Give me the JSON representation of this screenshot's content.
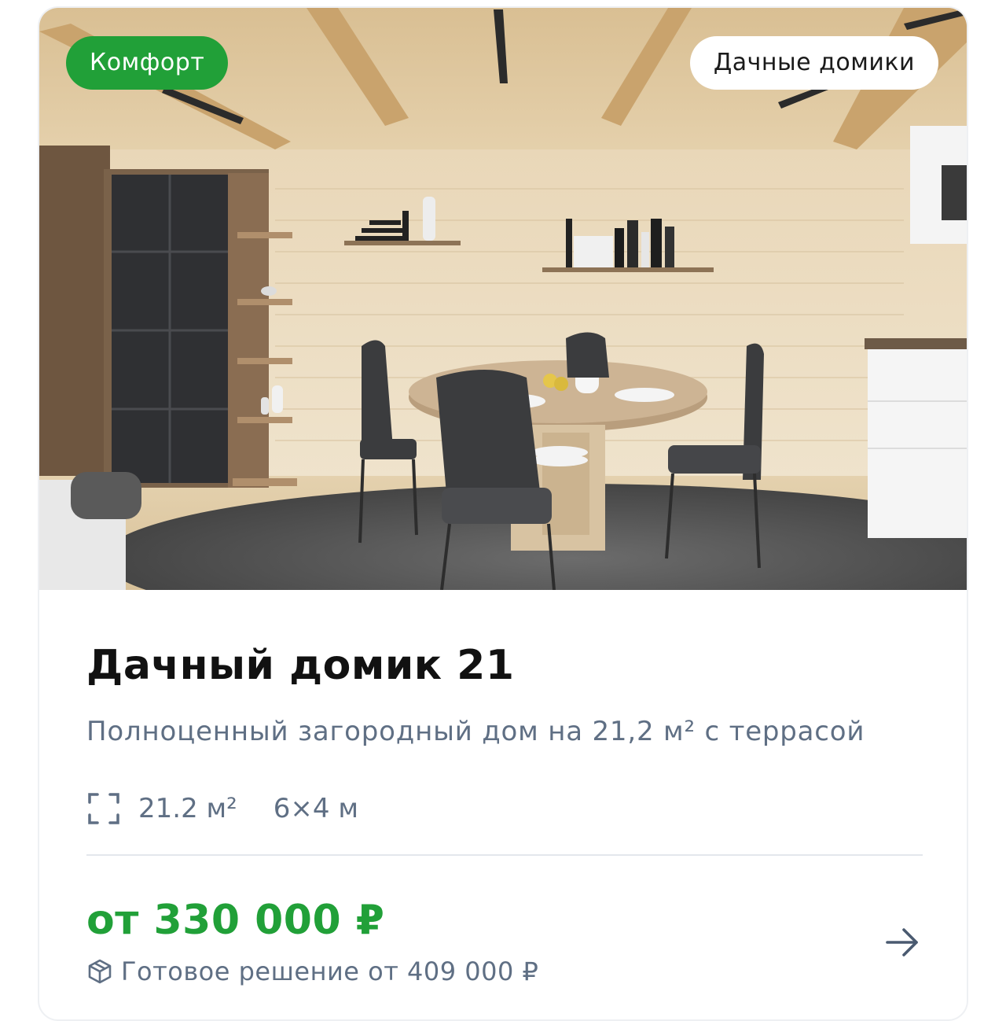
{
  "card": {
    "badge_level": "Комфорт",
    "badge_category": "Дачные домики",
    "title": "Дачный домик 21",
    "subtitle": "Полноценный загородный дом на 21,2 м² с террасой",
    "area": "21.2 м²",
    "dimensions": "6×4 м",
    "price": "от 330 000 ₽",
    "ready_solution": "Готовое решение от 409 000 ₽"
  },
  "icons": {
    "area": "area-frame-icon",
    "ready": "box-icon",
    "arrow": "arrow-right-icon"
  },
  "colors": {
    "accent": "#21a038",
    "muted_text": "#5f6f84",
    "title_text": "#111111"
  }
}
